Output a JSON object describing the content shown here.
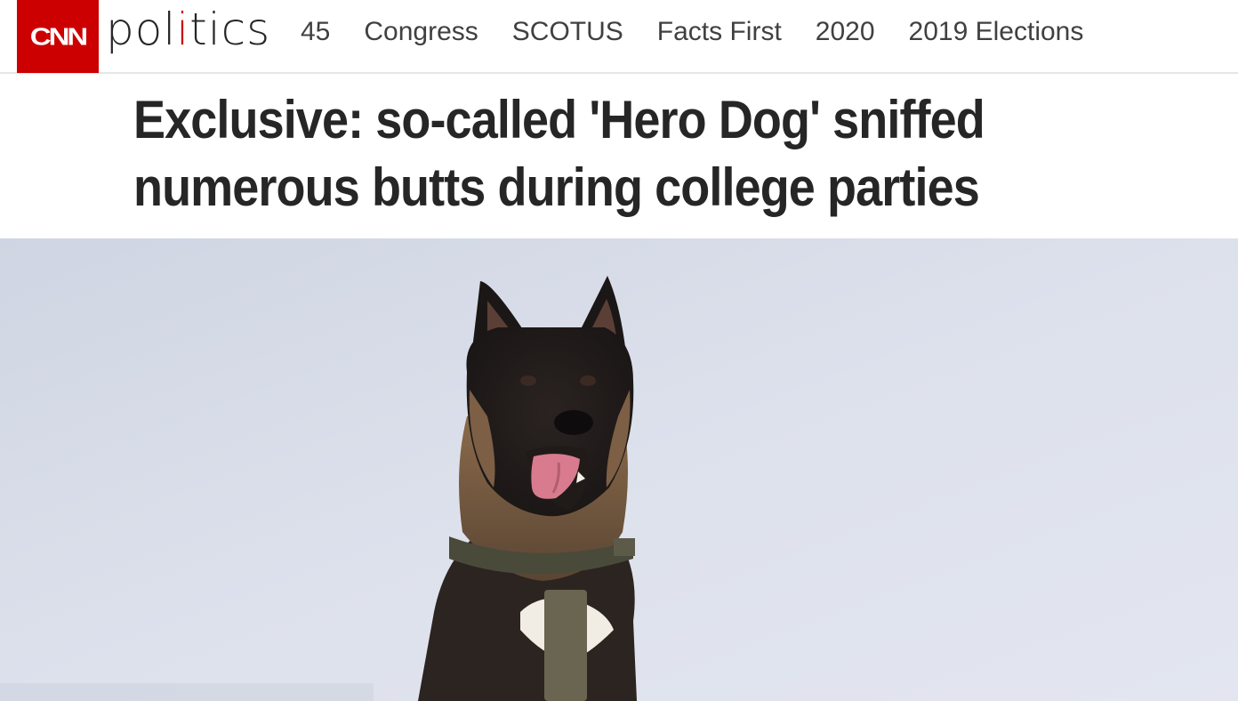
{
  "brand": {
    "logo_text": "CNN",
    "section_prefix": "pol",
    "section_accent": "i",
    "section_suffix": "tics",
    "brand_color": "#cc0000"
  },
  "nav": {
    "items": [
      "45",
      "Congress",
      "SCOTUS",
      "Facts First",
      "2020",
      "2019 Elections"
    ]
  },
  "article": {
    "headline_line1": "Exclusive: so-called 'Hero Dog' sniffed",
    "headline_line2": "numerous butts during college parties"
  },
  "photo": {
    "subject": "dog-photo",
    "background_color": "#d9dde8"
  }
}
